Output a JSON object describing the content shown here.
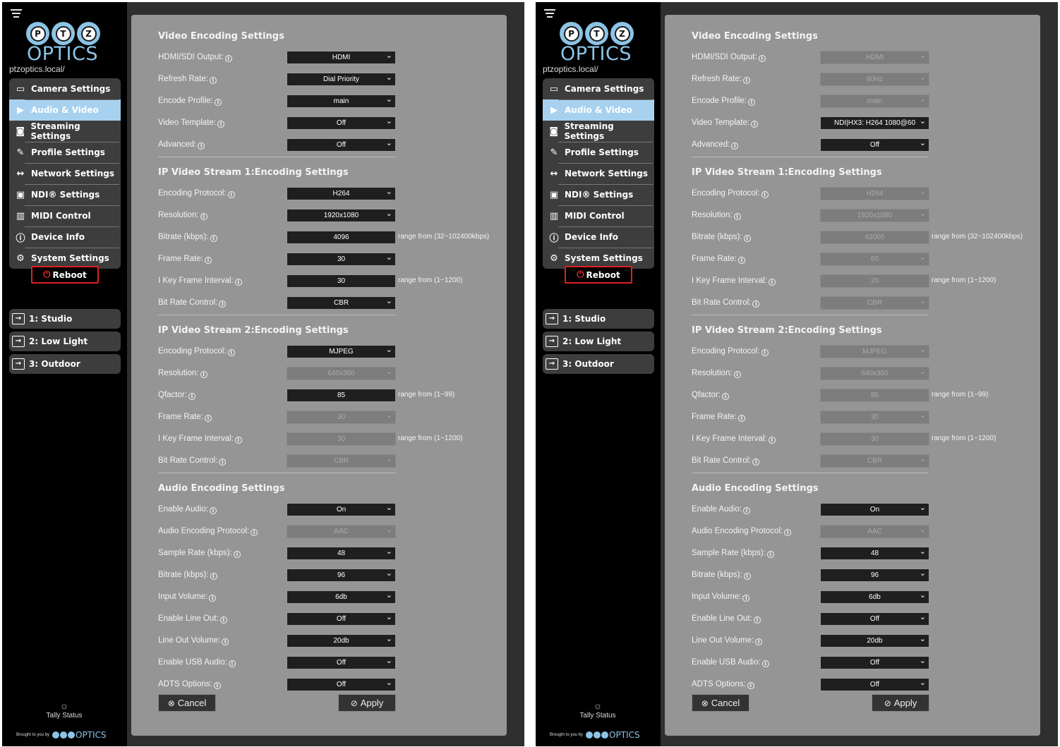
{
  "panels": [
    {
      "sidebar": {
        "logo": {
          "letters": [
            "P",
            "T",
            "Z"
          ],
          "word": "OPTICS"
        },
        "host": "ptzoptics.local/",
        "nav": [
          {
            "label": "Camera Settings",
            "icon": "video-camera-icon"
          },
          {
            "label": "Audio & Video",
            "icon": "audio-video-icon"
          },
          {
            "label": "Streaming Settings",
            "icon": "streaming-icon"
          },
          {
            "label": "Profile Settings",
            "icon": "profile-icon"
          },
          {
            "label": "Network Settings",
            "icon": "network-icon"
          },
          {
            "label": "NDI® Settings",
            "icon": "ndi-icon"
          },
          {
            "label": "MIDI Control",
            "icon": "midi-icon"
          },
          {
            "label": "Device Info",
            "icon": "info-icon"
          },
          {
            "label": "System Settings",
            "icon": "gear-icon"
          }
        ],
        "reboot": "Reboot",
        "presets": [
          "1: Studio",
          "2: Low Light",
          "3: Outdoor"
        ],
        "tally": "Tally Status",
        "brought": "Brought to you by",
        "brought_word": "OPTICS"
      },
      "sections": [
        {
          "title": "Video Encoding Settings",
          "rows": [
            {
              "label": "HDMI/SDI Output:",
              "value": "HDMI",
              "type": "select",
              "disabled": false
            },
            {
              "label": "Refresh Rate:",
              "value": "Dial Priority",
              "type": "select",
              "disabled": false
            },
            {
              "label": "Encode Profile:",
              "value": "main",
              "type": "select",
              "disabled": false
            },
            {
              "label": "Video Template:",
              "value": "Off",
              "type": "select",
              "disabled": false
            },
            {
              "label": "Advanced:",
              "value": "Off",
              "type": "select",
              "disabled": false
            }
          ]
        },
        {
          "title": "IP Video Stream 1:Encoding Settings",
          "rows": [
            {
              "label": "Encoding Protocol:",
              "value": "H264",
              "type": "select",
              "disabled": false
            },
            {
              "label": "Resolution:",
              "value": "1920x1080",
              "type": "select",
              "disabled": false
            },
            {
              "label": "Bitrate (kbps):",
              "value": "4096",
              "type": "input",
              "disabled": false,
              "hint": "range from (32~102400kbps)"
            },
            {
              "label": "Frame Rate:",
              "value": "30",
              "type": "select",
              "disabled": false
            },
            {
              "label": "I Key Frame Interval:",
              "value": "30",
              "type": "input",
              "disabled": false,
              "hint": "range from (1~1200)"
            },
            {
              "label": "Bit Rate Control:",
              "value": "CBR",
              "type": "select",
              "disabled": false
            }
          ]
        },
        {
          "title": "IP Video Stream 2:Encoding Settings",
          "rows": [
            {
              "label": "Encoding Protocol:",
              "value": "MJPEG",
              "type": "select",
              "disabled": false
            },
            {
              "label": "Resolution:",
              "value": "640x360",
              "type": "select",
              "disabled": true
            },
            {
              "label": "Qfactor:",
              "value": "85",
              "type": "input",
              "disabled": false,
              "hint": "range from (1~99)"
            },
            {
              "label": "Frame Rate:",
              "value": "30",
              "type": "select",
              "disabled": true
            },
            {
              "label": "I Key Frame Interval:",
              "value": "30",
              "type": "input",
              "disabled": true,
              "hint": "range from (1~1200)"
            },
            {
              "label": "Bit Rate Control:",
              "value": "CBR",
              "type": "select",
              "disabled": true
            }
          ]
        },
        {
          "title": "Audio Encoding Settings",
          "rows": [
            {
              "label": "Enable Audio:",
              "value": "On",
              "type": "select",
              "disabled": false
            },
            {
              "label": "Audio Encoding Protocol:",
              "value": "AAC",
              "type": "select",
              "disabled": true
            },
            {
              "label": "Sample Rate (kbps):",
              "value": "48",
              "type": "select",
              "disabled": false
            },
            {
              "label": "Bitrate (kbps):",
              "value": "96",
              "type": "select",
              "disabled": false
            },
            {
              "label": "Input Volume:",
              "value": "6db",
              "type": "select",
              "disabled": false
            },
            {
              "label": "Enable Line Out:",
              "value": "Off",
              "type": "select",
              "disabled": false
            },
            {
              "label": "Line Out Volume:",
              "value": "20db",
              "type": "select",
              "disabled": false
            },
            {
              "label": "Enable USB Audio:",
              "value": "Off",
              "type": "select",
              "disabled": false
            },
            {
              "label": "ADTS Options:",
              "value": "Off",
              "type": "select",
              "disabled": false
            }
          ]
        }
      ],
      "buttons": {
        "cancel": "Cancel",
        "apply": "Apply"
      }
    },
    {
      "sidebar": {
        "logo": {
          "letters": [
            "P",
            "T",
            "Z"
          ],
          "word": "OPTICS"
        },
        "host": "ptzoptics.local/",
        "nav": [
          {
            "label": "Camera Settings",
            "icon": "video-camera-icon"
          },
          {
            "label": "Audio & Video",
            "icon": "audio-video-icon"
          },
          {
            "label": "Streaming Settings",
            "icon": "streaming-icon"
          },
          {
            "label": "Profile Settings",
            "icon": "profile-icon"
          },
          {
            "label": "Network Settings",
            "icon": "network-icon"
          },
          {
            "label": "NDI® Settings",
            "icon": "ndi-icon"
          },
          {
            "label": "MIDI Control",
            "icon": "midi-icon"
          },
          {
            "label": "Device Info",
            "icon": "info-icon"
          },
          {
            "label": "System Settings",
            "icon": "gear-icon"
          }
        ],
        "reboot": "Reboot",
        "presets": [
          "1: Studio",
          "2: Low Light",
          "3: Outdoor"
        ],
        "tally": "Tally Status",
        "brought": "Brought to you by",
        "brought_word": "OPTICS"
      },
      "sections": [
        {
          "title": "Video Encoding Settings",
          "rows": [
            {
              "label": "HDMI/SDI Output:",
              "value": "HDMI",
              "type": "select",
              "disabled": true
            },
            {
              "label": "Refresh Rate:",
              "value": "60Hz",
              "type": "select",
              "disabled": true
            },
            {
              "label": "Encode Profile:",
              "value": "main",
              "type": "select",
              "disabled": true
            },
            {
              "label": "Video Template:",
              "value": "NDI|HX3: H264 1080@60",
              "type": "select",
              "disabled": false
            },
            {
              "label": "Advanced:",
              "value": "Off",
              "type": "select",
              "disabled": false
            }
          ]
        },
        {
          "title": "IP Video Stream 1:Encoding Settings",
          "rows": [
            {
              "label": "Encoding Protocol:",
              "value": "H264",
              "type": "select",
              "disabled": true
            },
            {
              "label": "Resolution:",
              "value": "1920x1080",
              "type": "select",
              "disabled": true
            },
            {
              "label": "Bitrate (kbps):",
              "value": "62000",
              "type": "input",
              "disabled": true,
              "hint": "range from (32~102400kbps)"
            },
            {
              "label": "Frame Rate:",
              "value": "60",
              "type": "select",
              "disabled": true
            },
            {
              "label": "I Key Frame Interval:",
              "value": "20",
              "type": "input",
              "disabled": true,
              "hint": "range from (1~1200)"
            },
            {
              "label": "Bit Rate Control:",
              "value": "CBR",
              "type": "select",
              "disabled": true
            }
          ]
        },
        {
          "title": "IP Video Stream 2:Encoding Settings",
          "rows": [
            {
              "label": "Encoding Protocol:",
              "value": "MJPEG",
              "type": "select",
              "disabled": true
            },
            {
              "label": "Resolution:",
              "value": "640x360",
              "type": "select",
              "disabled": true
            },
            {
              "label": "Qfactor:",
              "value": "85",
              "type": "input",
              "disabled": true,
              "hint": "range from (1~99)"
            },
            {
              "label": "Frame Rate:",
              "value": "30",
              "type": "select",
              "disabled": true
            },
            {
              "label": "I Key Frame Interval:",
              "value": "30",
              "type": "input",
              "disabled": true,
              "hint": "range from (1~1200)"
            },
            {
              "label": "Bit Rate Control:",
              "value": "CBR",
              "type": "select",
              "disabled": true
            }
          ]
        },
        {
          "title": "Audio Encoding Settings",
          "rows": [
            {
              "label": "Enable Audio:",
              "value": "On",
              "type": "select",
              "disabled": false
            },
            {
              "label": "Audio Encoding Protocol:",
              "value": "AAC",
              "type": "select",
              "disabled": true
            },
            {
              "label": "Sample Rate (kbps):",
              "value": "48",
              "type": "select",
              "disabled": false
            },
            {
              "label": "Bitrate (kbps):",
              "value": "96",
              "type": "select",
              "disabled": false
            },
            {
              "label": "Input Volume:",
              "value": "6db",
              "type": "select",
              "disabled": false
            },
            {
              "label": "Enable Line Out:",
              "value": "Off",
              "type": "select",
              "disabled": false
            },
            {
              "label": "Line Out Volume:",
              "value": "20db",
              "type": "select",
              "disabled": false
            },
            {
              "label": "Enable USB Audio:",
              "value": "Off",
              "type": "select",
              "disabled": false
            },
            {
              "label": "ADTS Options:",
              "value": "Off",
              "type": "select",
              "disabled": false
            }
          ]
        }
      ],
      "buttons": {
        "cancel": "Cancel",
        "apply": "Apply"
      }
    }
  ]
}
